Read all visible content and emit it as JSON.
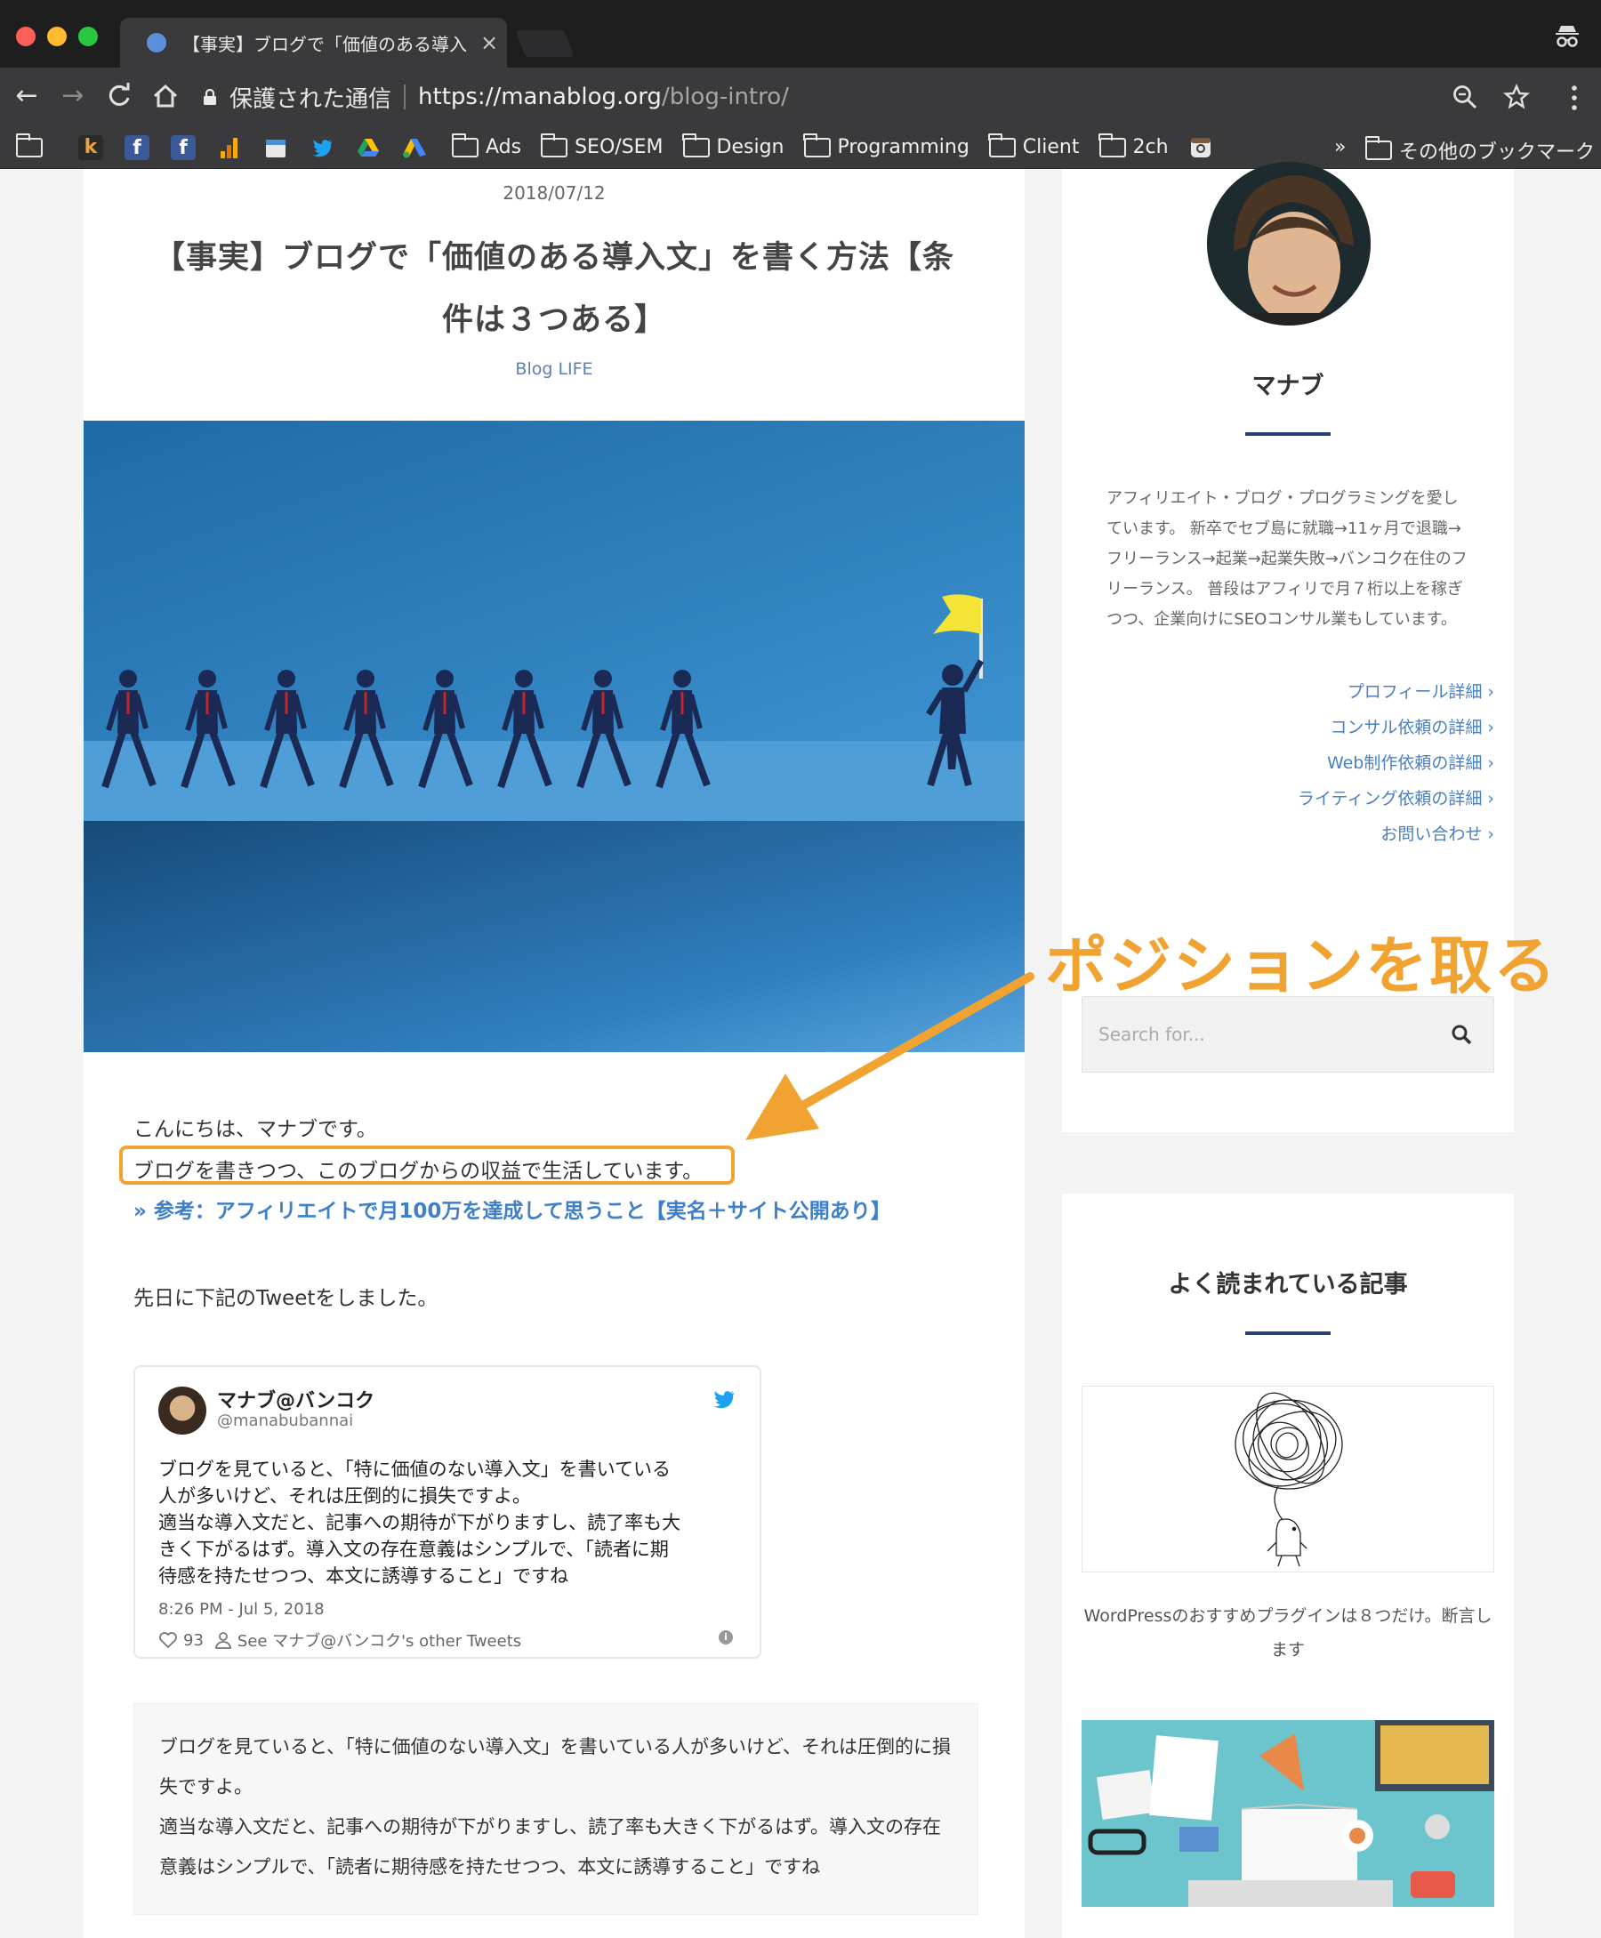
{
  "browser": {
    "tab_title": "【事実】ブログで「価値のある導入",
    "tab_close": "×",
    "secure_label": "保護された通信",
    "url_host": "https://manablog.org",
    "url_path": "/blog-intro/",
    "bookmarks": [
      "Ads",
      "SEO/SEM",
      "Design",
      "Programming",
      "Client",
      "2ch"
    ],
    "bookmarks_more": "»",
    "other_bookmarks": "その他のブックマーク"
  },
  "post": {
    "date": "2018/07/12",
    "title": "【事実】ブログで「価値のある導入文」を書く方法【条件は３つある】",
    "category": "Blog LIFE",
    "intro_1": "こんにちは、マナブです。",
    "intro_2": "ブログを書きつつ、このブログからの収益で生活しています。",
    "ref_link": "» 参考：アフィリエイトで月100万を達成して思うこと【実名＋サイト公開あり】",
    "tweet_intro": "先日に下記のTweetをしました。",
    "tweet": {
      "name": "マナブ@バンコク",
      "handle": "@manabubannai",
      "text": "ブログを見ていると、「特に価値のない導入文」を書いている\n人が多いけど、それは圧倒的に損失ですよ。\n適当な導入文だと、記事への期待が下がりますし、読了率も大\nきく下がるはず。導入文の存在意義はシンプルで、「読者に期\n待感を持たせつつ、本文に誘導すること」ですね",
      "time": "8:26 PM - Jul 5, 2018",
      "likes": "93",
      "see_other": "See マナブ@バンコク's other Tweets"
    },
    "quote_1": "ブログを見ていると、「特に価値のない導入文」を書いている人が多いけど、それは圧倒的に損失ですよ。",
    "quote_2": "適当な導入文だと、記事への期待が下がりますし、読了率も大きく下がるはず。導入文の存在意義はシンプルで、「読者に期待感を持たせつつ、本文に誘導すること」ですね"
  },
  "sidebar": {
    "name": "マナブ",
    "bio": "アフィリエイト・ブログ・プログラミングを愛しています。 新卒でセブ島に就職→11ヶ月で退職→フリーランス→起業→起業失敗→バンコク在住のフリーランス。 普段はアフィリで月７桁以上を稼ぎつつ、企業向けにSEOコンサル業もしています。",
    "links": [
      "プロフィール詳細 ›",
      "コンサル依頼の詳細 ›",
      "Web制作依頼の詳細 ›",
      "ライティング依頼の詳細 ›",
      "お問い合わせ ›"
    ],
    "search_placeholder": "Search for...",
    "popular_heading": "よく読まれている記事",
    "article_1": "WordPressのおすすめプラグインは８つだけ。断言します"
  },
  "annotation": {
    "text": "ポジションを取る",
    "color": "#f0a330"
  }
}
